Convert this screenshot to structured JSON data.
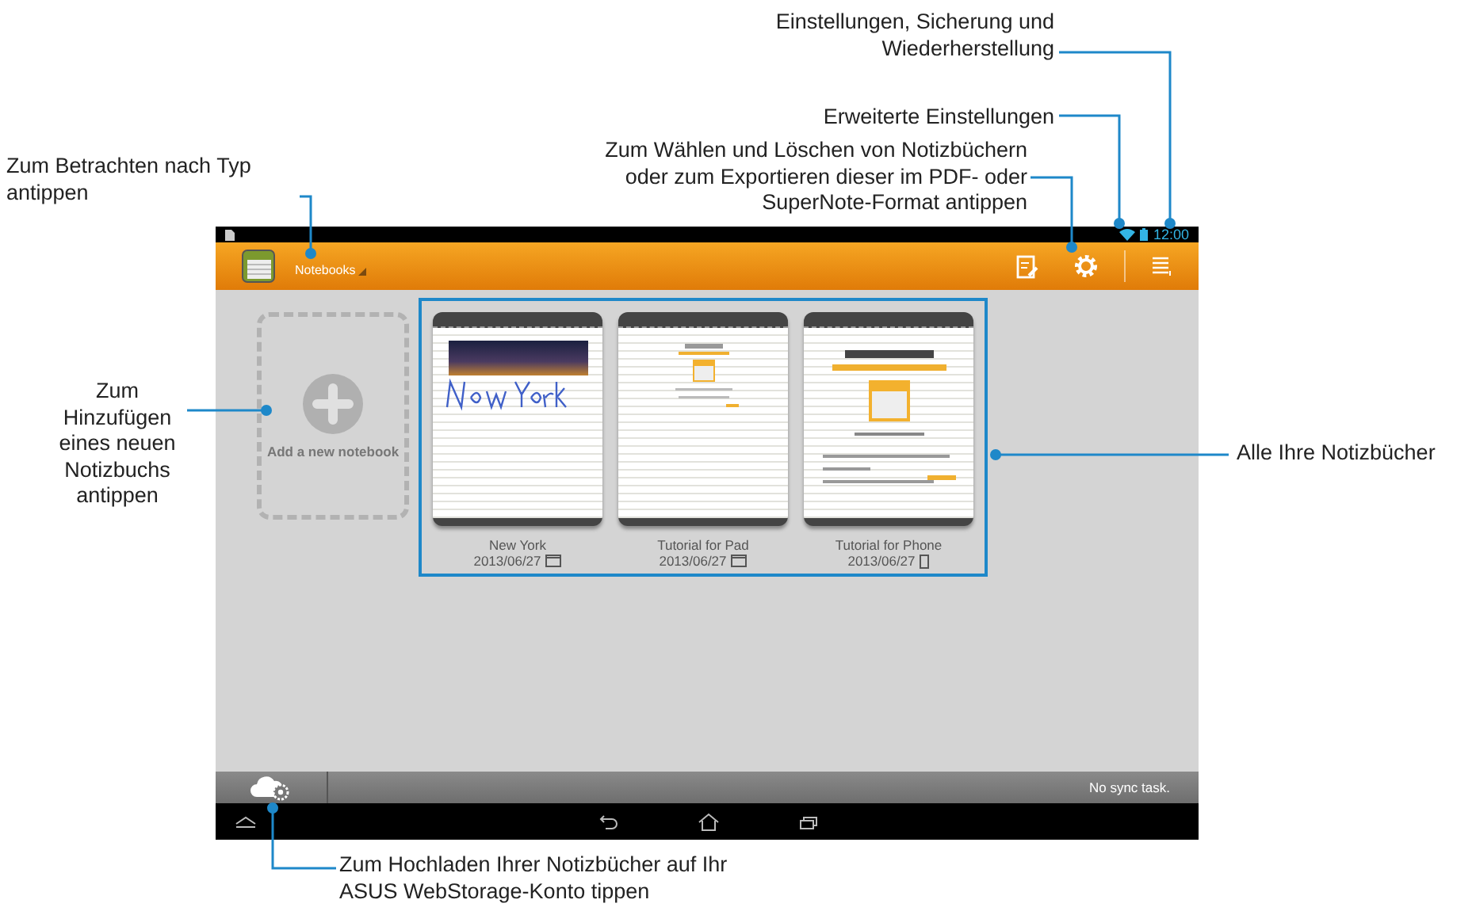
{
  "annotations": [
    {
      "kind": "top-right",
      "lines": [
        "Einstellungen, Sicherung und",
        "Wiederherstellung"
      ]
    },
    {
      "kind": "top-mid",
      "lines": [
        "Erweiterte Einstellungen"
      ]
    },
    {
      "kind": "type",
      "lines": [
        "Zum Betrachten nach Typ",
        "antippen"
      ]
    },
    {
      "kind": "top-left",
      "lines": [
        "Zum Wählen und Löschen von Notizbüchern",
        "oder zum Exportieren dieser im PDF- oder",
        "SuperNote-Format antippen"
      ]
    },
    {
      "kind": "add",
      "lines": [
        "Zum",
        "Hinzufügen",
        "eines neuen",
        "Notizbuchs",
        "antippen"
      ]
    },
    {
      "kind": "all",
      "lines": [
        "Alle Ihre Notizbücher"
      ]
    },
    {
      "kind": "upload",
      "lines": [
        "Zum Hochladen Ihrer Notizbücher auf Ihr",
        "ASUS WebStorage-Konto tippen"
      ]
    }
  ],
  "status_bar": {
    "time": "12:00"
  },
  "action_bar": {
    "title": "Notebooks"
  },
  "add_tile": {
    "label": "Add a new notebook"
  },
  "notebooks": [
    {
      "name": "New York",
      "date": "2013/06/27",
      "kind": "pad"
    },
    {
      "name": "Tutorial for Pad",
      "date": "2013/06/27",
      "kind": "pad"
    },
    {
      "name": "Tutorial for Phone",
      "date": "2013/06/27",
      "kind": "phone"
    }
  ],
  "bottom_bar": {
    "sync_status": "No sync task."
  }
}
